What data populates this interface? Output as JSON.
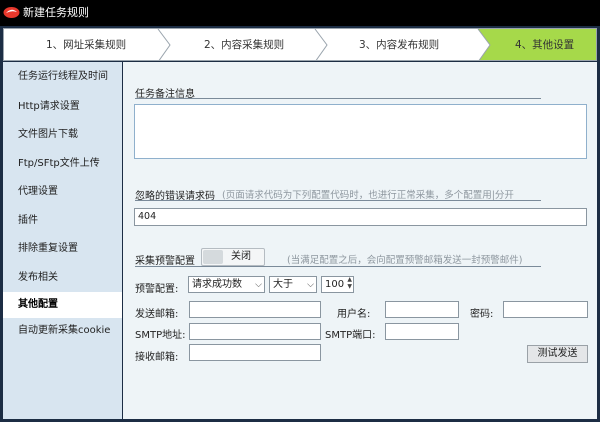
{
  "window": {
    "title": "新建任务规则"
  },
  "steps": [
    {
      "label": "1、网址采集规则",
      "active": false
    },
    {
      "label": "2、内容采集规则",
      "active": false
    },
    {
      "label": "3、内容发布规则",
      "active": false
    },
    {
      "label": "4、其他设置",
      "active": true
    }
  ],
  "sidebar": {
    "items": [
      {
        "label": "任务运行线程及时间"
      },
      {
        "label": "Http请求设置"
      },
      {
        "label": "文件图片下载"
      },
      {
        "label": "Ftp/SFtp文件上传"
      },
      {
        "label": "代理设置"
      },
      {
        "label": "插件"
      },
      {
        "label": "排除重复设置"
      },
      {
        "label": "发布相关"
      },
      {
        "label": "其他配置",
        "active": true
      },
      {
        "label": "自动更新采集cookie"
      }
    ]
  },
  "notes": {
    "title": "任务备注信息",
    "value": ""
  },
  "ignore": {
    "title": "忽略的错误请求码",
    "hint": "(页面请求代码为下列配置代码时，也进行正常采集，多个配置用|分开",
    "value": "404"
  },
  "alert": {
    "title": "采集预警配置",
    "toggle_label": "关闭",
    "hint": "(当满足配置之后，会向配置预警邮箱发送一封预警邮件)",
    "config_label": "预警配置:",
    "condition": "请求成功数",
    "operator": "大于",
    "threshold": "100",
    "sender_label": "发送邮箱:",
    "sender": "",
    "username_label": "用户名:",
    "username": "",
    "password_label": "密码:",
    "password": "",
    "smtp_label": "SMTP地址:",
    "smtp": "",
    "port_label": "SMTP端口:",
    "port": "",
    "receiver_label": "接收邮箱:",
    "receiver": "",
    "test_button": "测试发送"
  },
  "colors": {
    "step_active": "#a6d94a",
    "sidebar_bg": "#d8e5f0",
    "content_bg": "#eef4f7"
  }
}
